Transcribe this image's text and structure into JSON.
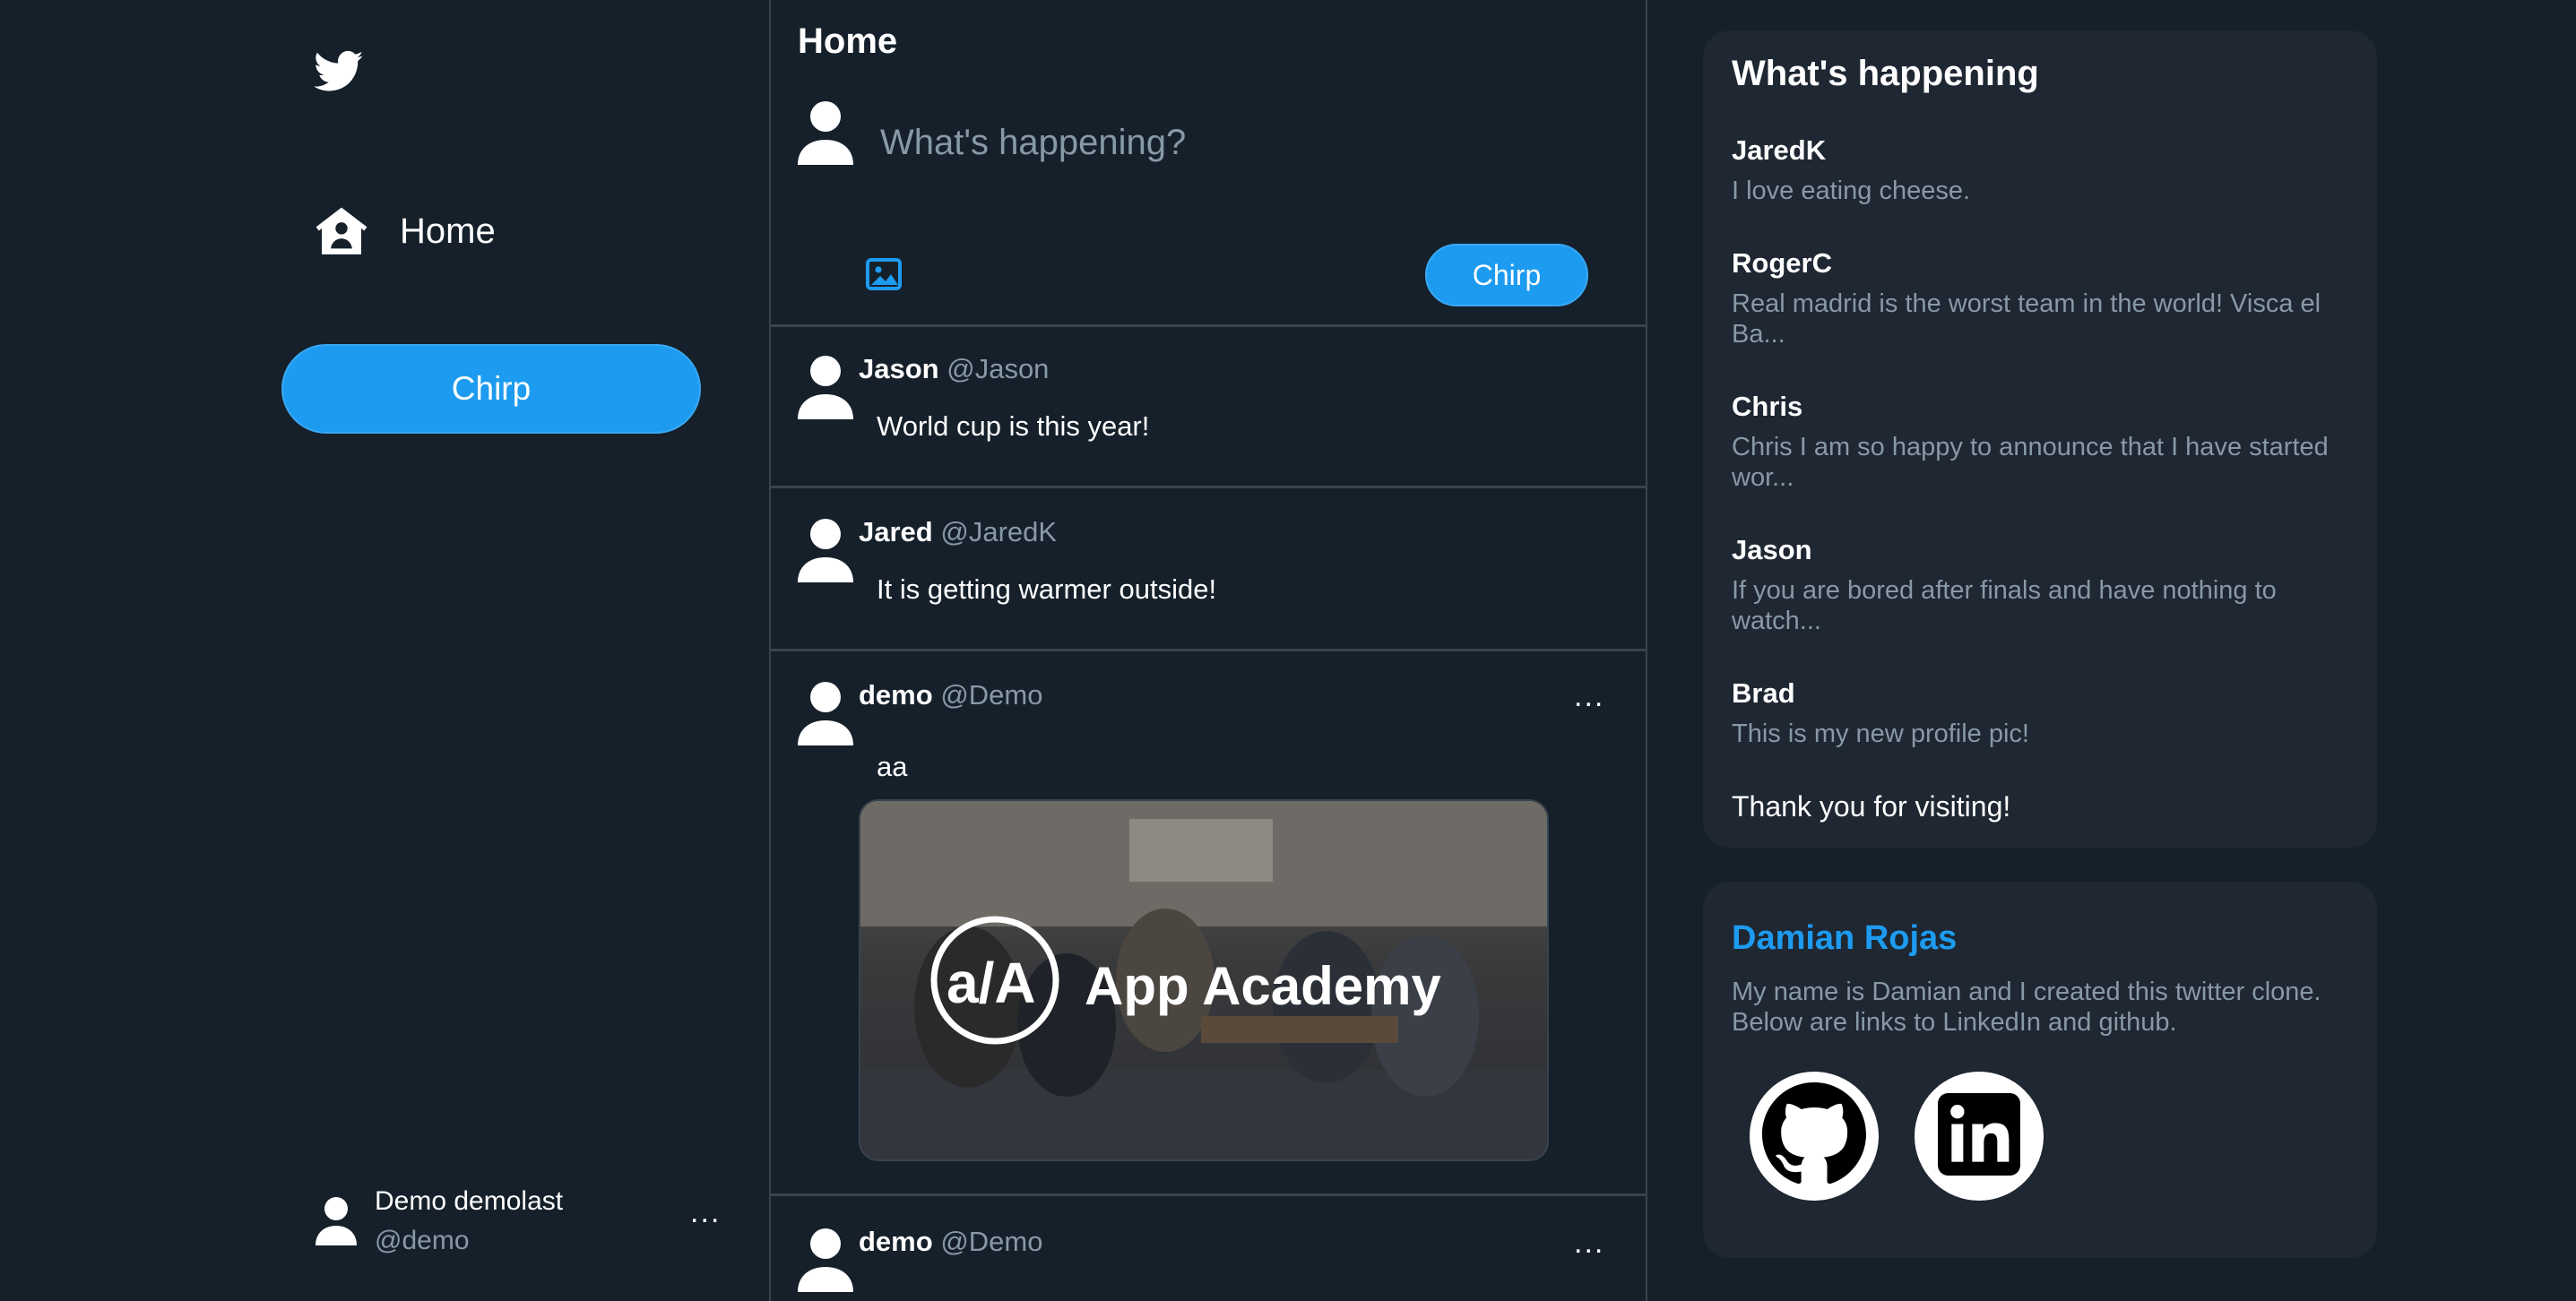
{
  "sidebar": {
    "logo_icon": "twitter-bird-icon",
    "home_label": "Home",
    "chirp_label": "Chirp",
    "account": {
      "name": "Demo demolast",
      "handle": "@demo",
      "more": "..."
    }
  },
  "main": {
    "title": "Home",
    "compose": {
      "placeholder": "What's happening?",
      "chirp_label": "Chirp",
      "image_icon": "image-icon"
    },
    "posts": [
      {
        "name": "Jason",
        "handle": "@Jason",
        "text": "World cup is this year!"
      },
      {
        "name": "Jared",
        "handle": "@JaredK",
        "text": "It is getting warmer outside!"
      },
      {
        "name": "demo",
        "handle": "@Demo",
        "text": "aa",
        "more": "...",
        "media_text": "App Academy",
        "media_logo": "a/A"
      },
      {
        "name": "demo",
        "handle": "@Demo",
        "more": "..."
      }
    ]
  },
  "trends": {
    "title": "What's happening",
    "items": [
      {
        "user": "JaredK",
        "text": "I love eating cheese."
      },
      {
        "user": "RogerC",
        "text": "Real madrid is the worst team in the world! Visca el Ba..."
      },
      {
        "user": "Chris",
        "text": "Chris I am so happy to announce that I have started wor..."
      },
      {
        "user": "Jason",
        "text": "If you are bored after finals and have nothing to watch..."
      },
      {
        "user": "Brad",
        "text": "This is my new profile pic!"
      }
    ],
    "footer": "Thank you for visiting!"
  },
  "profile": {
    "name": "Damian Rojas",
    "bio": "My name is Damian and I created this twitter clone. Below are links to LinkedIn and github.",
    "links": [
      "github-icon",
      "linkedin-icon"
    ]
  },
  "colors": {
    "background": "#15202b",
    "panel": "#1e2732",
    "accent": "#1d9bf0",
    "muted": "#8899a6",
    "border": "#38444d"
  }
}
